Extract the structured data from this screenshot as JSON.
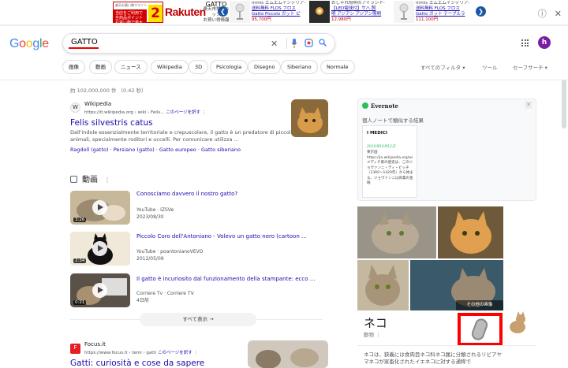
{
  "ad": {
    "banner_top": "楽天お買い物マラソン",
    "banner_red": "当店をご利用で全商品ポイントお買い物で最大",
    "banner_big": "2",
    "brand": "Rakuten",
    "shop_name": "GATTO",
    "shop_sub1": "楽天市場ショップ",
    "shop_sub2": "お買い得情報",
    "items": [
      {
        "l1": "mmis エムエムインテリア-",
        "l2": "送料無料 FLOS フロス",
        "l3": "Gatto Piccolo ガット ピ",
        "price": "95,700円"
      },
      {
        "l1": "おしゃれ照明のアイランド-",
        "l2": "【LED電球付】サハ 照",
        "l3": "明 アジアン アジアン照明",
        "price": "12,980円"
      },
      {
        "l1": "mmis エムエムインテリア-",
        "l2": "送料無料 FLOS フロス",
        "l3": "Gatto ガット テーブルラ",
        "price": "111,100円"
      }
    ]
  },
  "header": {
    "logo": "Google",
    "query": "GATTO",
    "avatar": "h"
  },
  "chips": [
    "画像",
    "動画",
    "ニュース",
    "Wikipedia",
    "3D",
    "Psicologia",
    "Disegno",
    "Siberiano",
    "Normale"
  ],
  "tools": {
    "filters": "すべてのフィルタ ▾",
    "tools": "ツール",
    "safesearch": "セーフサーチ ▾"
  },
  "stats": "約 102,000,000 件 （0.42 秒）",
  "result1": {
    "site": "Wikipedia",
    "url": "https://it.wikipedia.org › wiki › Felis...",
    "translate": "このページを訳す",
    "title": "Felis silvestris catus",
    "snippet1": "Dall'indole essenzialmente territoriale e crepuscolare, il gatto è un predatore di piccoli",
    "snippet2": "animali, specialmente roditori e uccelli. Per comunicare utilizza ...",
    "sublinks": "Ragdoll (gatto) · Persiano (gatto) · Gatto europeo · Gatto siberiano"
  },
  "videos": {
    "heading": "動画",
    "items": [
      {
        "title": "Conosciamo davvero il nostro gatto?",
        "source": "YouTube · IZSVe",
        "date": "2023/08/30",
        "duration": "3:26"
      },
      {
        "title": "Piccolo Coro dell'Antoniano - Volevo un gatto nero (cartoon ...",
        "source": "YouTube · poantonianoVEVO",
        "date": "2012/05/09",
        "duration": "2:34"
      },
      {
        "title": "Il gatto è incuriosito dal funzionamento della stampante: ecco ...",
        "source": "Corriere Tv · Corriere TV",
        "date": "4日前",
        "duration": "0:21"
      }
    ],
    "show_all": "すべて表示 →"
  },
  "result2": {
    "site": "Focus.it",
    "url": "https://www.focus.it › temi › gatti",
    "translate": "このページを訳す",
    "title": "Gatti: curiosità e cose da sapere"
  },
  "evernote": {
    "brand": "Evernote",
    "subtitle": "個人ノートで類似する結果",
    "card_title": "I MEDICI",
    "card_date": "2018年10月12日",
    "card_body": "東京国 https://ja.wikipedia.org/wi メディチ家の歴史は、このジョヴァンニ・ディ・ビッチ（1360〜1429年）から始まる。ジョヴァンニは商業の金融"
  },
  "knowledge": {
    "title": "ネコ",
    "subtitle": "動物",
    "more_images": "その他の画像",
    "desc": "ネコは、狭義には食肉目ネコ科ネコ属に分類されるリビアヤマネコが家畜化されたイエネコに対する通称で"
  }
}
